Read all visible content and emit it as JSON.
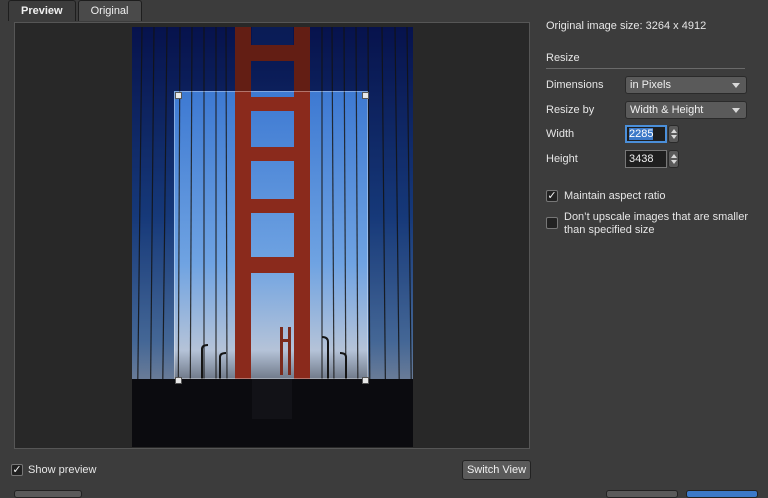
{
  "tabs": [
    {
      "label": "Preview",
      "active": true
    },
    {
      "label": "Original",
      "active": false
    }
  ],
  "info": {
    "original_size_label": "Original image size: 3264 x 4912"
  },
  "resize": {
    "section_title": "Resize",
    "dimensions_label": "Dimensions",
    "dimensions_value": "in Pixels",
    "resize_by_label": "Resize by",
    "resize_by_value": "Width & Height",
    "width_label": "Width",
    "width_value": "2285",
    "height_label": "Height",
    "height_value": "3438",
    "maintain_aspect_label": "Maintain aspect ratio",
    "maintain_aspect_checked": true,
    "no_upscale_label_line1": "Don’t upscale images that are smaller",
    "no_upscale_label_line2": "than specified size",
    "no_upscale_checked": false
  },
  "footer": {
    "show_preview_label": "Show preview",
    "show_preview_checked": true,
    "switch_view_label": "Switch View"
  },
  "colors": {
    "accent": "#4b8fd9",
    "panel_bg": "#3c3c3c",
    "preview_bg": "#282828"
  }
}
